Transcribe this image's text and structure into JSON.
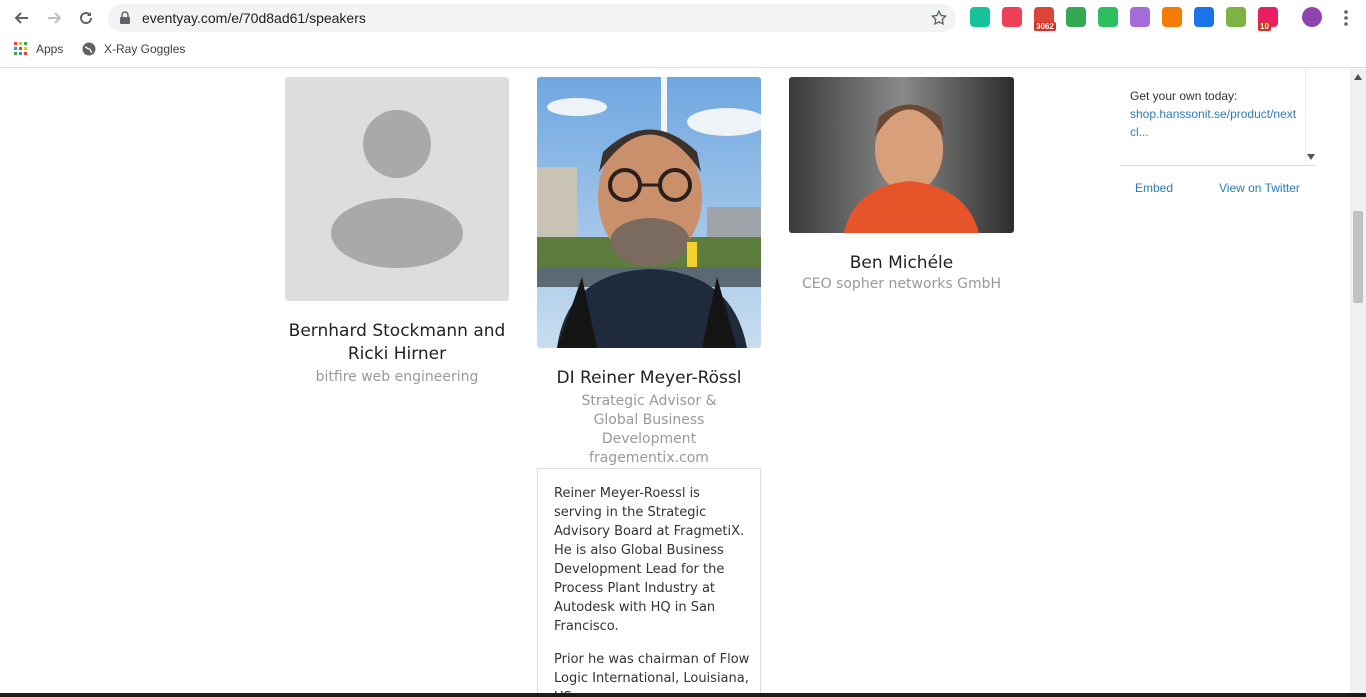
{
  "browser": {
    "url": "eventyay.com/e/70d8ad61/speakers",
    "bookmarks": [
      {
        "label": "Apps",
        "icon": "apps-grid-icon"
      },
      {
        "label": "X-Ray Goggles",
        "icon": "globe-icon"
      }
    ],
    "extensions": [
      {
        "name": "grammarly-icon",
        "color": "#15c39a"
      },
      {
        "name": "pocket-icon",
        "color": "#ef4056"
      },
      {
        "name": "gmail-icon",
        "color": "#db4437",
        "badge": "3062"
      },
      {
        "name": "drive-icon",
        "color": "#34a853"
      },
      {
        "name": "evernote-icon",
        "color": "#2dbe60"
      },
      {
        "name": "extension-purple-icon",
        "color": "#a56bd8"
      },
      {
        "name": "chart-icon",
        "color": "#f57c00"
      },
      {
        "name": "check-icon",
        "color": "#1a73e8"
      },
      {
        "name": "extension-green-icon",
        "color": "#7cb342"
      },
      {
        "name": "extension-pink-icon",
        "color": "#e91e63",
        "badge": "10"
      },
      {
        "name": "profile-avatar-icon",
        "color": "#8e44ad"
      }
    ]
  },
  "speakers": [
    {
      "name": "Bernhard Stockmann and\nRicki Hirner",
      "role": "bitfire web engineering",
      "photo": "placeholder"
    },
    {
      "name": "DI Reiner Meyer-Rössl",
      "role": "Strategic Advisor & Global Business Development fragementix.com",
      "photo": "man-glasses"
    },
    {
      "name": "Ben Michéle",
      "role": "CEO sopher networks GmbH",
      "photo": "man-orange-sweater"
    }
  ],
  "bio": {
    "p1": "Reiner Meyer-Roessl is serving in the Strategic Advisory Board at FragmetiX.\nHe is also Global Business Development Lead for the Process Plant Industry at Autodesk with HQ in San Francisco.",
    "p2": "Prior he was chairman of Flow Logic International, Louisiana, US..."
  },
  "twitter": {
    "text": "Get your own today:",
    "link": "shop.hanssonit.se/product/nextcl...",
    "embed": "Embed",
    "view": "View on Twitter"
  }
}
